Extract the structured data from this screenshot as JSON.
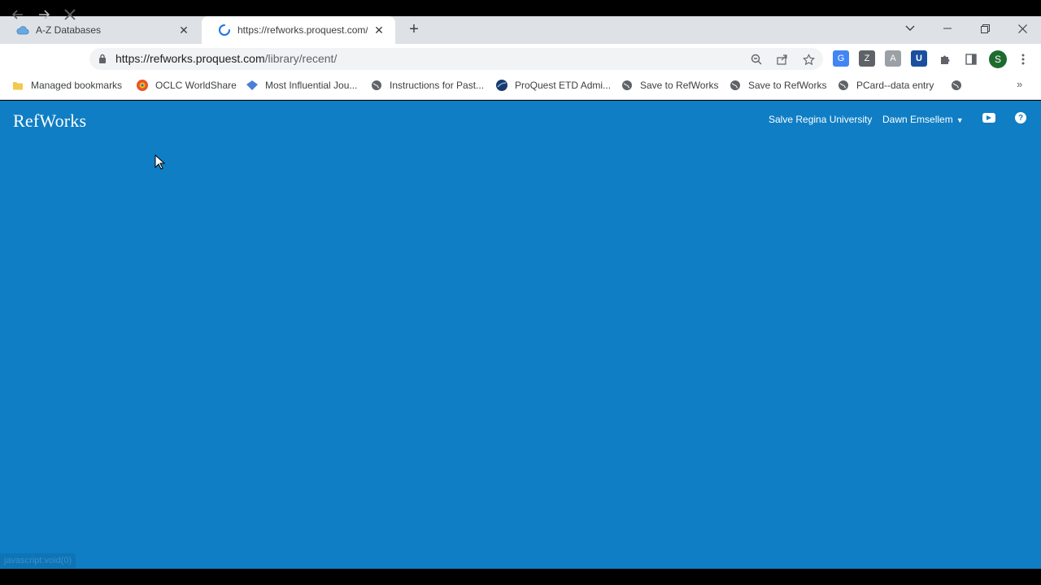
{
  "browser": {
    "tabs": [
      {
        "title": "A-Z Databases",
        "icon": "cloud-icon"
      },
      {
        "title": "https://refworks.proquest.com/lil",
        "icon": "loading-spinner-icon"
      }
    ],
    "address": {
      "host": "https://refworks.proquest.com",
      "path": "/library/recent/"
    },
    "bookmarks": [
      {
        "label": "Managed bookmarks",
        "icon": "folder-icon"
      },
      {
        "label": "OCLC WorldShare",
        "icon": "oclc-icon"
      },
      {
        "label": "Most Influential Jou...",
        "icon": "diamond-icon"
      },
      {
        "label": "Instructions for Past...",
        "icon": "globe-icon"
      },
      {
        "label": "ProQuest ETD Admi...",
        "icon": "proquest-icon"
      },
      {
        "label": "Save to RefWorks",
        "icon": "globe-icon"
      },
      {
        "label": "Save to RefWorks",
        "icon": "globe-icon"
      },
      {
        "label": "PCard--data entry",
        "icon": "globe-icon"
      },
      {
        "label": "",
        "icon": "globe-icon"
      }
    ],
    "profile_initial": "S",
    "status_text": "javascript:void(0)"
  },
  "app": {
    "brand": "RefWorks",
    "institution": "Salve Regina University",
    "user": "Dawn Emsellem",
    "user_caret": "▼",
    "help_label": "?"
  },
  "colors": {
    "page_bg": "#0f7ec4",
    "tab_strip": "#dee1e6"
  }
}
